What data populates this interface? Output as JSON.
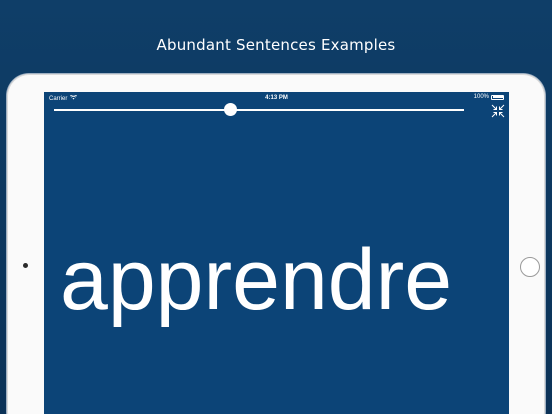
{
  "headline": "Abundant Sentences Examples",
  "statusbar": {
    "carrier": "Carrier",
    "wifi_icon": "wifi-icon",
    "time": "4:13 PM",
    "battery_percent": "100%",
    "battery_level": 1.0
  },
  "slider": {
    "value": 0.43
  },
  "collapse_icon": "collapse-arrows-icon",
  "word": "apprendre",
  "colors": {
    "background": "#0f3e68",
    "screen": "#0c4477",
    "text": "#ffffff"
  }
}
